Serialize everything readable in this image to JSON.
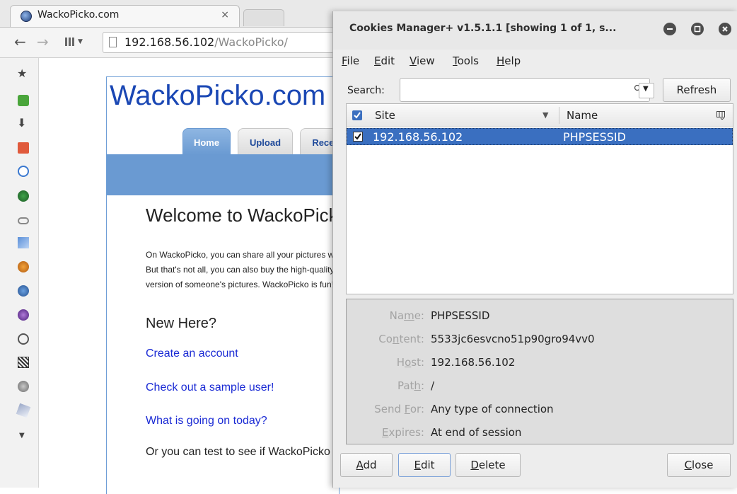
{
  "browser": {
    "tab_title": "WackoPicko.com",
    "tab_close": "×",
    "url_host": "192.168.56.102",
    "url_path": "/WackoPicko/",
    "back_glyph": "←",
    "forward_glyph": "→"
  },
  "sidebar_icons": [
    "star-icon",
    "puzzle-icon",
    "download-icon",
    "web-developer-icon",
    "info-bubble-icon",
    "green-circle-icon",
    "chain-link-icon",
    "cursor-select-icon",
    "firebug-icon",
    "swirl-icon",
    "virus-icon",
    "palette-icon",
    "qr-code-icon",
    "globe-icon",
    "eraser-icon"
  ],
  "webpage": {
    "site_title": "WackoPicko.com",
    "nav_tabs": [
      {
        "label": "Home",
        "active": true
      },
      {
        "label": "Upload",
        "active": false
      },
      {
        "label": "Recent",
        "active": false
      }
    ],
    "welcome": "Welcome to WackoPicko",
    "paragraph": [
      "On WackoPicko, you can share all your pictures with the world!",
      "But that's not all, you can also buy the high-quality",
      "version of someone's pictures. WackoPicko is fun!"
    ],
    "new_here": "New Here?",
    "links": [
      "Create an account",
      "Check out a sample user!",
      "What is going on today?"
    ],
    "test_text": "Or you can test to see if WackoPicko can handle a file:"
  },
  "dialog": {
    "title": "Cookies Manager+ v1.5.1.1 [showing 1 of 1, s...",
    "menu": [
      {
        "label": "File",
        "key": "F",
        "rest": "ile"
      },
      {
        "label": "Edit",
        "key": "E",
        "rest": "dit"
      },
      {
        "label": "View",
        "key": "V",
        "rest": "iew"
      },
      {
        "label": "Tools",
        "key": "T",
        "rest": "ools"
      },
      {
        "label": "Help",
        "key": "H",
        "rest": "elp"
      }
    ],
    "search_label": "Search:",
    "search_value": "",
    "refresh_label": "Refresh",
    "columns": {
      "site": "Site",
      "name": "Name"
    },
    "rows": [
      {
        "checked": true,
        "site": "192.168.56.102",
        "name": "PHPSESSID",
        "selected": true
      }
    ],
    "details": {
      "name": {
        "pre": "Na",
        "key": "m",
        "post": "e:",
        "value": "PHPSESSID"
      },
      "content": {
        "pre": "Co",
        "key": "n",
        "post": "tent:",
        "value": "5533jc6esvcno51p90gro94vv0"
      },
      "host": {
        "pre": "H",
        "key": "o",
        "post": "st:",
        "value": "192.168.56.102"
      },
      "path": {
        "pre": "Pat",
        "key": "h",
        "post": ":",
        "value": "/"
      },
      "send_for": {
        "pre": "Send ",
        "key": "F",
        "post": "or:",
        "value": "Any type of connection"
      },
      "expires": {
        "pre": "",
        "key": "E",
        "post": "xpires:",
        "value": "At end of session"
      }
    },
    "buttons": {
      "add": {
        "key": "A",
        "rest": "dd"
      },
      "edit": {
        "key": "E",
        "rest": "dit"
      },
      "delete": {
        "key": "D",
        "rest": "elete"
      },
      "close": {
        "key": "C",
        "rest": "lose"
      }
    }
  }
}
